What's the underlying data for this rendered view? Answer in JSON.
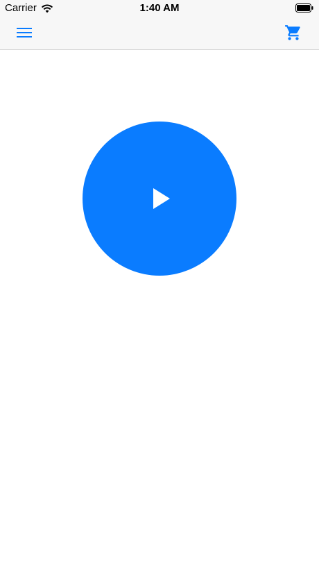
{
  "status_bar": {
    "carrier": "Carrier",
    "time": "1:40 AM",
    "wifi_icon": "wifi-icon",
    "battery_icon": "battery-icon"
  },
  "nav_bar": {
    "menu_icon": "hamburger-menu-icon",
    "cart_icon": "shopping-cart-icon"
  },
  "main": {
    "play_button_icon": "play-icon"
  },
  "colors": {
    "accent": "#0a7cff",
    "bar_background": "#f7f7f7",
    "background": "#ffffff"
  }
}
